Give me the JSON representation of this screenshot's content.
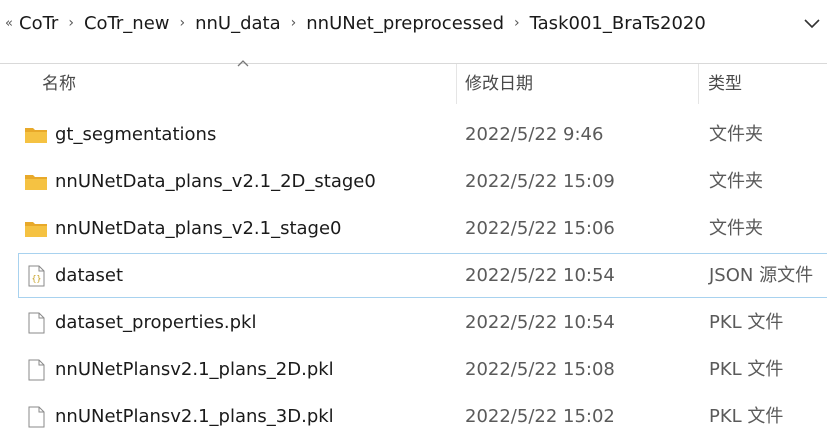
{
  "breadcrumb": {
    "overflow": "«",
    "items": [
      "CoTr",
      "CoTr_new",
      "nnU_data",
      "nnUNet_preprocessed",
      "Task001_BraTs2020"
    ],
    "separator": "›"
  },
  "columns": {
    "name": "名称",
    "date": "修改日期",
    "type": "类型"
  },
  "files": [
    {
      "name": "gt_segmentations",
      "date": "2022/5/22 9:46",
      "type": "文件夹",
      "icon": "folder-icon"
    },
    {
      "name": "nnUNetData_plans_v2.1_2D_stage0",
      "date": "2022/5/22 15:09",
      "type": "文件夹",
      "icon": "folder-icon"
    },
    {
      "name": "nnUNetData_plans_v2.1_stage0",
      "date": "2022/5/22 15:06",
      "type": "文件夹",
      "icon": "folder-icon"
    },
    {
      "name": "dataset",
      "date": "2022/5/22 10:54",
      "type": "JSON 源文件",
      "icon": "json-file-icon"
    },
    {
      "name": "dataset_properties.pkl",
      "date": "2022/5/22 10:54",
      "type": "PKL 文件",
      "icon": "file-icon"
    },
    {
      "name": "nnUNetPlansv2.1_plans_2D.pkl",
      "date": "2022/5/22 15:08",
      "type": "PKL 文件",
      "icon": "file-icon"
    },
    {
      "name": "nnUNetPlansv2.1_plans_3D.pkl",
      "date": "2022/5/22 15:02",
      "type": "PKL 文件",
      "icon": "file-icon"
    }
  ],
  "colors": {
    "folder": "#f5c242",
    "folder_dark": "#e8a92a",
    "hover_border": "#a8d2ef",
    "json_brace": "#c29a16"
  }
}
